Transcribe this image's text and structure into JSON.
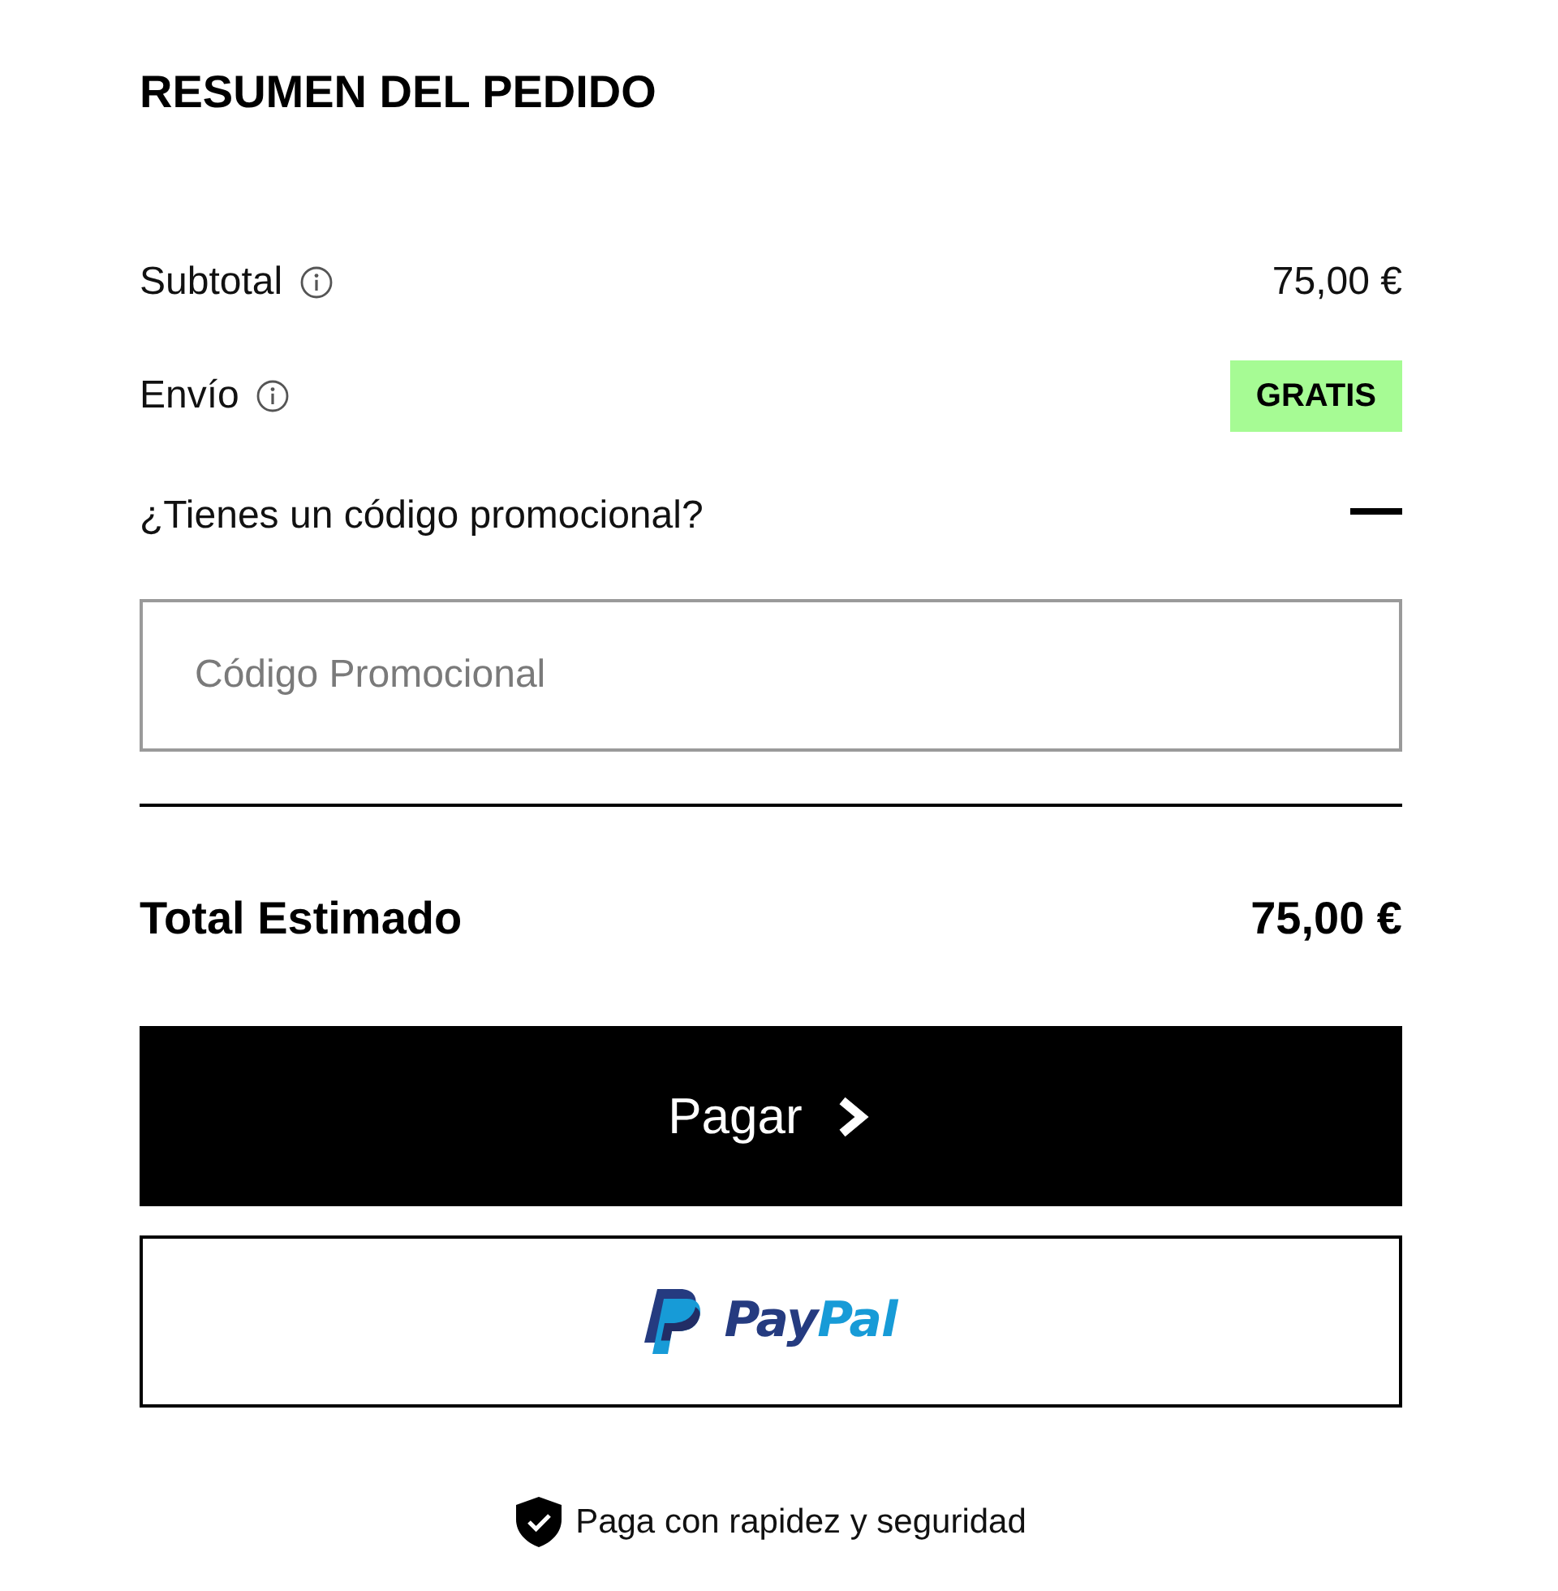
{
  "title": "RESUMEN DEL PEDIDO",
  "summary_rows": [
    {
      "label": "Subtotal",
      "kind": "amount",
      "value": "75,00 €"
    },
    {
      "label": "Envío",
      "kind": "badge",
      "value": "GRATIS"
    }
  ],
  "promo": {
    "question": "¿Tienes un código promocional?",
    "expanded": true,
    "field": {
      "placeholder": "Código Promocional"
    }
  },
  "total": {
    "label": "Total Estimado",
    "value": "75,00 €"
  },
  "pay_button": {
    "label": "Pagar"
  },
  "paypal_button": {
    "logo_parts": [
      {
        "text": "Pay",
        "color": "#253b80"
      },
      {
        "text": "Pal",
        "color": "#179bd7"
      }
    ]
  },
  "footer": {
    "text": "Paga con rapidez y seguridad"
  }
}
